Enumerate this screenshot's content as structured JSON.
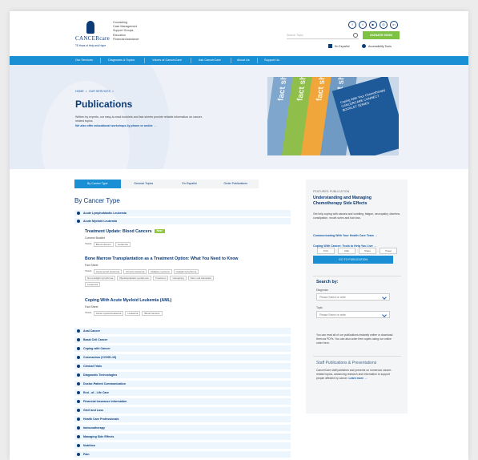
{
  "header": {
    "logo_text": "CANCERcare",
    "logo_tagline": "75 Years of Help and Hope",
    "services": [
      "Counseling",
      "Case Management",
      "Support Groups",
      "Education",
      "Financial Assistance"
    ],
    "social_icons": [
      "facebook-icon",
      "twitter-icon",
      "youtube-icon",
      "instagram-icon",
      "linkedin-icon"
    ],
    "search_placeholder": "Search Topic",
    "donate_label": "DONATE NOW",
    "language_label": "En Español",
    "accessibility_label": "Accessibility Tools"
  },
  "nav": {
    "items": [
      "Our Services",
      "Diagnoses & Topics",
      "Voices of CancerCare",
      "Ask CancerCare",
      "About Us",
      "Support Us"
    ]
  },
  "hero": {
    "breadcrumb": [
      "HOME",
      "OUR SERVICES"
    ],
    "breadcrumb_sep": ">",
    "title": "Publications",
    "intro": "Written by experts, our easy-to-read booklets and fact sheets provide reliable information on cancer-related topics.",
    "intro_link": "We also offer educational workshops by phone or online →",
    "image_sheets": [
      "fact sheet",
      "fact sheet",
      "fact sheet",
      "fact sheet"
    ],
    "image_book": "Coping With Your Chemotherapy CANCERCARE CONNECT BOOKLET SERIES"
  },
  "tabs": [
    "By Cancer Type",
    "General Topics",
    "En Español",
    "Order Publications"
  ],
  "section_title": "By Cancer Type",
  "top_accordions": [
    "Acute Lymphoblastic Leukemia",
    "Acute Myeloid Leukemia"
  ],
  "publications": [
    {
      "title": "Treatment Update: Blood Cancers",
      "badge": "New",
      "type": "Connect Booklet",
      "tags_label": "TAGS:",
      "tags": [
        "Blood cancers",
        "Leukemia"
      ]
    },
    {
      "title": "Bone Marrow Transplantation as a Treatment Option: What You Need to Know",
      "badge": "",
      "type": "Fact Sheet",
      "tags_label": "TAGS:",
      "tags": [
        "Acute lymph leukemia",
        "Chronic leukemia",
        "Multiple myeloma",
        "Hodgkin lymphoma",
        "Non-Hodgkin lymphoma",
        "Myelodysplastic syndromes",
        "Treatment",
        "Caregiving",
        "Stem cell transplant",
        "Leukemia"
      ]
    },
    {
      "title": "Coping With Acute Myeloid Leukemia (AML)",
      "badge": "",
      "type": "Fact Sheet",
      "tags_label": "TAGS:",
      "tags": [
        "Acute myeloid leukemia",
        "Leukemia",
        "Blood cancers"
      ]
    }
  ],
  "bottom_accordions": [
    "Anal Cancer",
    "Basal Cell Cancer",
    "Coping with Cancer",
    "Coronavirus (COVID-19)",
    "Clinical Trials",
    "Diagnostic Technologies",
    "Doctor-Patient Communication",
    "End - of - Life Care",
    "Financial Insurance Information",
    "Grief and Loss",
    "Health Care Professionals",
    "Immunotherapy",
    "Managing Side Effects",
    "Nutrition",
    "Pain"
  ],
  "sidebar": {
    "kicker": "FEATURED PUBLICATION",
    "title": "Understanding and Managing Chemotherapy Side Effects",
    "body": "Get help coping with nausea and vomiting, fatigue, neuropathy, diarrhea, constipation, mouth sores and hair loss.",
    "link1": "Communicating With Your Health Care Team →",
    "link2": "Coping With Cancer: Tools to Help You Live →",
    "button": "GO TO PUBLICATION",
    "search_heading": "Search by:",
    "field1_label": "Diagnosis",
    "field1_value": "Please Select or write",
    "field2_label": "Topic",
    "field2_value": "Please Select or write",
    "note": "You can read all of our publications instantly online or download them as PDFs. You can also order free copies using our online order form.",
    "staff_title": "Staff Publications & Presentations",
    "staff_body": "CancerCare staff publishes and presents on numerous cancer-related topics, advancing research and information to support people affected by cancer.",
    "staff_link": "Learn more →",
    "share_buttons": [
      "Print",
      "Mail",
      "Share",
      "Tweet"
    ]
  }
}
